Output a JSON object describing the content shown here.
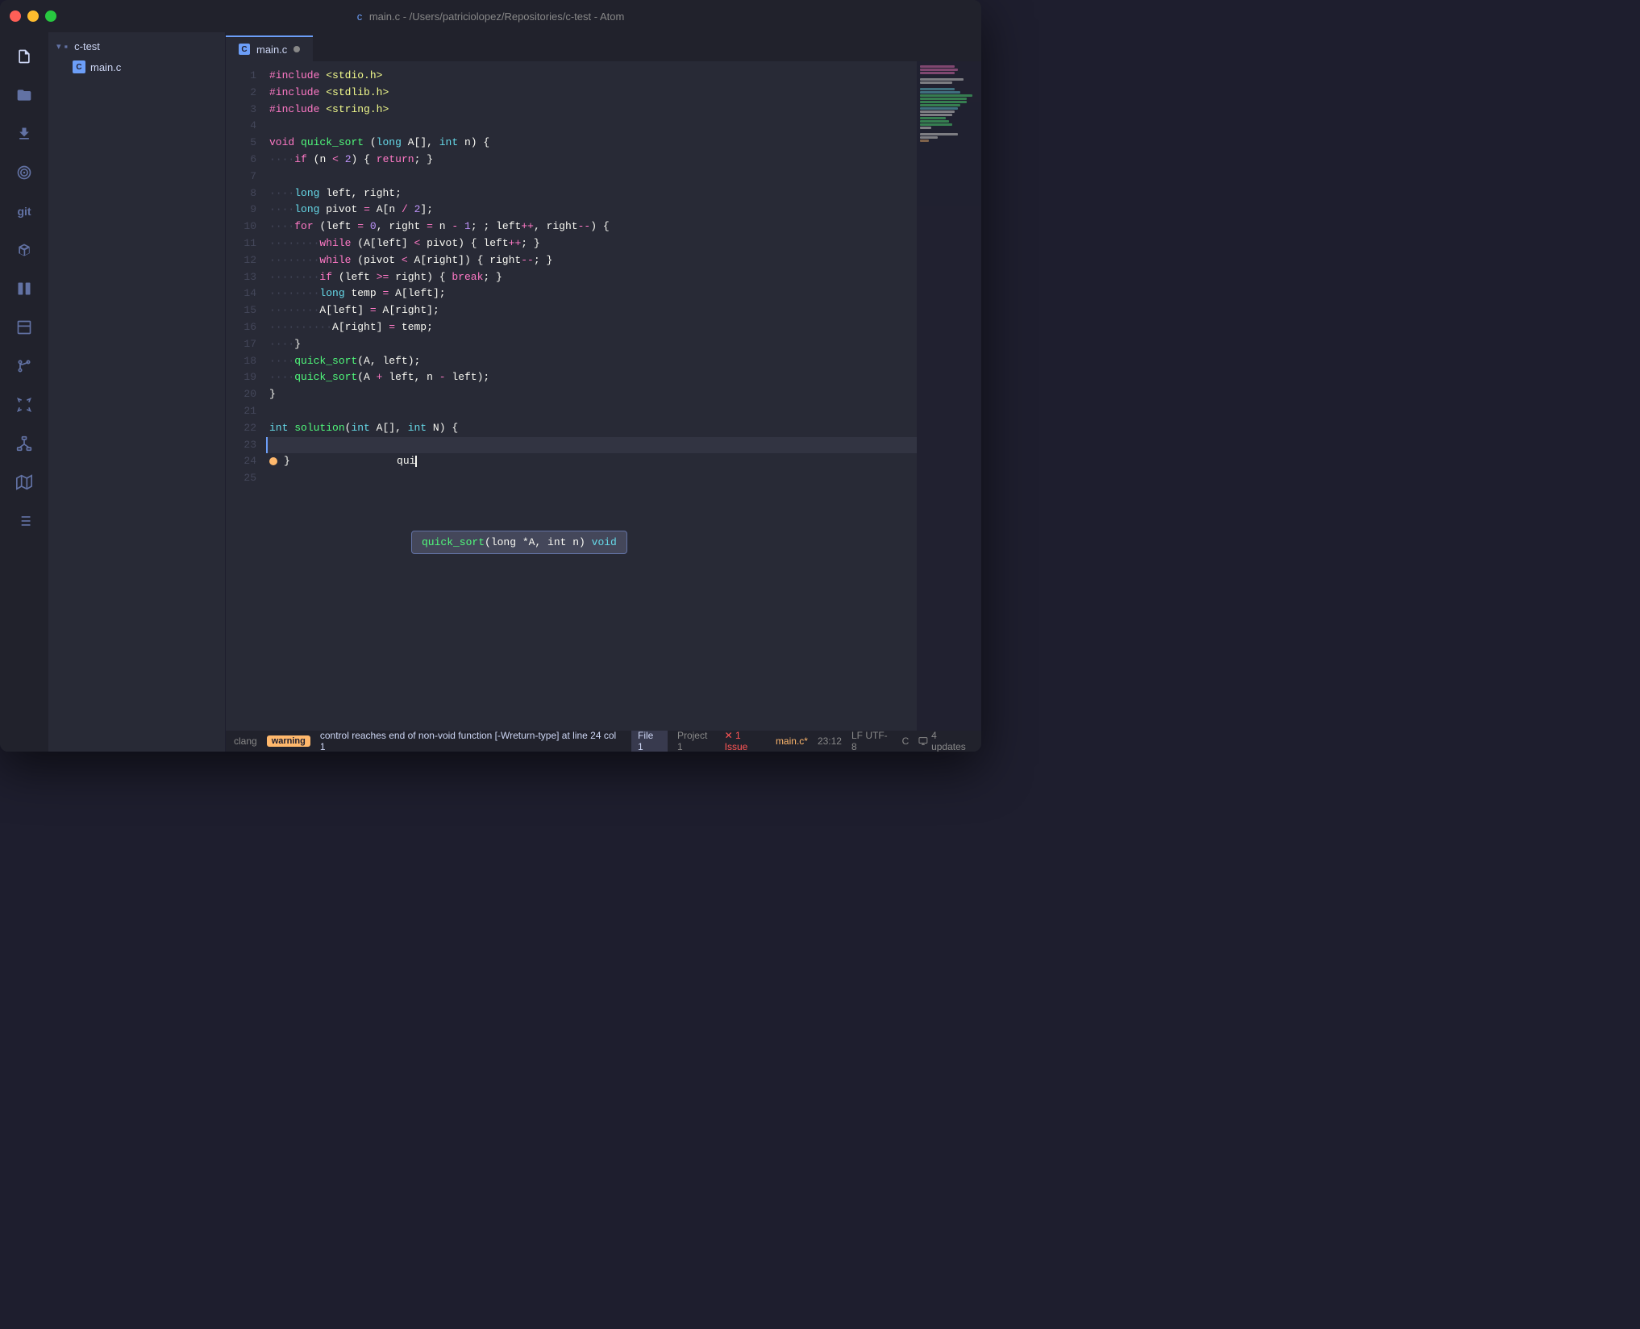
{
  "window": {
    "title": "main.c - /Users/patriciolopez/Repositories/c-test - Atom"
  },
  "titlebar": {
    "title": "main.c - /Users/patriciolopez/Repositories/c-test - Atom"
  },
  "sidebar": {
    "project_name": "c-test",
    "file_name": "main.c"
  },
  "tabs": [
    {
      "label": "main.c",
      "active": true
    }
  ],
  "activity_bar": {
    "icons": [
      "file-icon",
      "folder-icon",
      "download-icon",
      "target-icon",
      "git-icon",
      "package-icon",
      "split-icon",
      "pane-icon",
      "branch-icon",
      "expand-icon",
      "network-icon",
      "map-icon",
      "list-icon"
    ]
  },
  "code": {
    "lines": [
      {
        "num": 1,
        "content": "#include <stdio.h>"
      },
      {
        "num": 2,
        "content": "#include <stdlib.h>"
      },
      {
        "num": 3,
        "content": "#include <string.h>"
      },
      {
        "num": 4,
        "content": ""
      },
      {
        "num": 5,
        "content": "void quick_sort (long A[], int n) {"
      },
      {
        "num": 6,
        "content": "    if (n < 2) { return; }"
      },
      {
        "num": 7,
        "content": ""
      },
      {
        "num": 8,
        "content": "    long left, right;"
      },
      {
        "num": 9,
        "content": "    long pivot = A[n / 2];"
      },
      {
        "num": 10,
        "content": "    for (left = 0, right = n - 1; ; left++, right--) {"
      },
      {
        "num": 11,
        "content": "        while (A[left] < pivot) { left++; }"
      },
      {
        "num": 12,
        "content": "        while (pivot < A[right]) { right--; }"
      },
      {
        "num": 13,
        "content": "        if (left >= right) { break; }"
      },
      {
        "num": 14,
        "content": "        long temp = A[left];"
      },
      {
        "num": 15,
        "content": "        A[left] = A[right];"
      },
      {
        "num": 16,
        "content": "        A[right] = temp;"
      },
      {
        "num": 17,
        "content": "    }"
      },
      {
        "num": 18,
        "content": "    quick_sort(A, left);"
      },
      {
        "num": 19,
        "content": "    quick_sort(A + left, n - left);"
      },
      {
        "num": 20,
        "content": "}"
      },
      {
        "num": 21,
        "content": ""
      },
      {
        "num": 22,
        "content": "int solution(int A[], int N) {"
      },
      {
        "num": 23,
        "content": "        qui"
      },
      {
        "num": 24,
        "content": "}"
      },
      {
        "num": 25,
        "content": ""
      }
    ]
  },
  "autocomplete": {
    "text": "quick_sort(long *A, int n) void"
  },
  "status_bar": {
    "clang": "clang",
    "warning_label": "warning",
    "warning_message": "control reaches end of non-void function [-Wreturn-type] at line 24 col 1",
    "file_label": "File 1",
    "project_label": "Project 1",
    "issue_label": "✕ 1 Issue",
    "filename": "main.c*",
    "position": "23:12",
    "encoding": "LF  UTF-8",
    "language": "C",
    "updates": "4 updates"
  }
}
